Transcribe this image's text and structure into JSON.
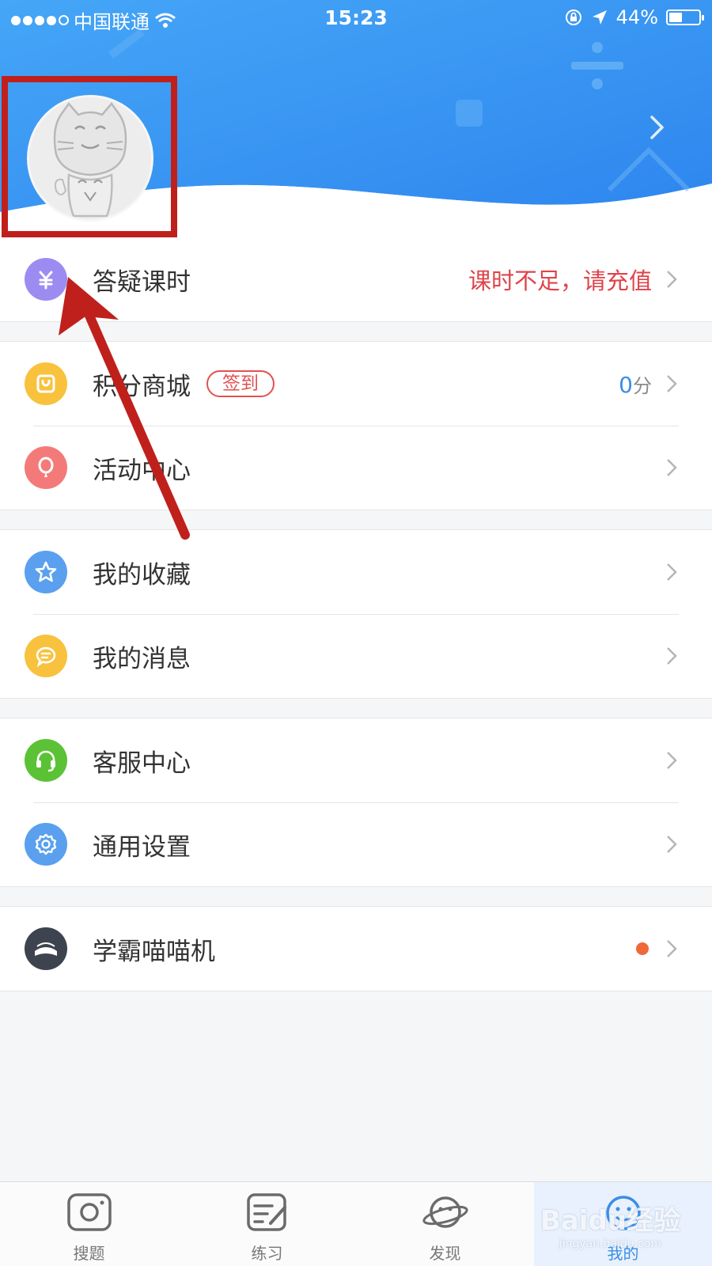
{
  "status_bar": {
    "carrier": "中国联通",
    "time": "15:23",
    "battery_text": "44%",
    "battery_level": 0.44
  },
  "profile": {
    "avatar_icon": "cat-avatar-icon",
    "chevron_icon": "chevron-right-icon"
  },
  "menu": {
    "groups": [
      {
        "items": [
          {
            "label": "答疑课时",
            "icon": "yen-icon",
            "color": "#9c8cf2",
            "value": "课时不足，请充值"
          }
        ]
      },
      {
        "items": [
          {
            "label": "积分商城",
            "icon": "shopping-bag-icon",
            "color": "#f9c23c",
            "badge": "签到",
            "value": "0",
            "unit": "分"
          },
          {
            "label": "活动中心",
            "icon": "balloon-icon",
            "color": "#f47a7a"
          }
        ]
      },
      {
        "items": [
          {
            "label": "我的收藏",
            "icon": "star-icon",
            "color": "#5aa0ef"
          },
          {
            "label": "我的消息",
            "icon": "message-icon",
            "color": "#f8c23f"
          }
        ]
      },
      {
        "items": [
          {
            "label": "客服中心",
            "icon": "headset-icon",
            "color": "#5bc235"
          },
          {
            "label": "通用设置",
            "icon": "gear-icon",
            "color": "#5aa0ef"
          }
        ]
      },
      {
        "items": [
          {
            "label": "学霸喵喵机",
            "icon": "printer-icon",
            "color": "#3e4350",
            "dot": true
          }
        ]
      }
    ]
  },
  "tabbar": {
    "tabs": [
      {
        "label": "搜题",
        "icon": "camera-icon"
      },
      {
        "label": "练习",
        "icon": "edit-note-icon"
      },
      {
        "label": "发现",
        "icon": "planet-icon"
      },
      {
        "label": "我的",
        "icon": "smiley-face-icon",
        "active": true
      }
    ]
  },
  "watermark": {
    "brand": "Baidu经验",
    "url": "jingyan.baidu.com"
  },
  "colors": {
    "header_blue": "#2f8cf0",
    "annotation_red": "#c0201b",
    "alert_red": "#e0434b",
    "accent_blue": "#3a8ee6"
  }
}
